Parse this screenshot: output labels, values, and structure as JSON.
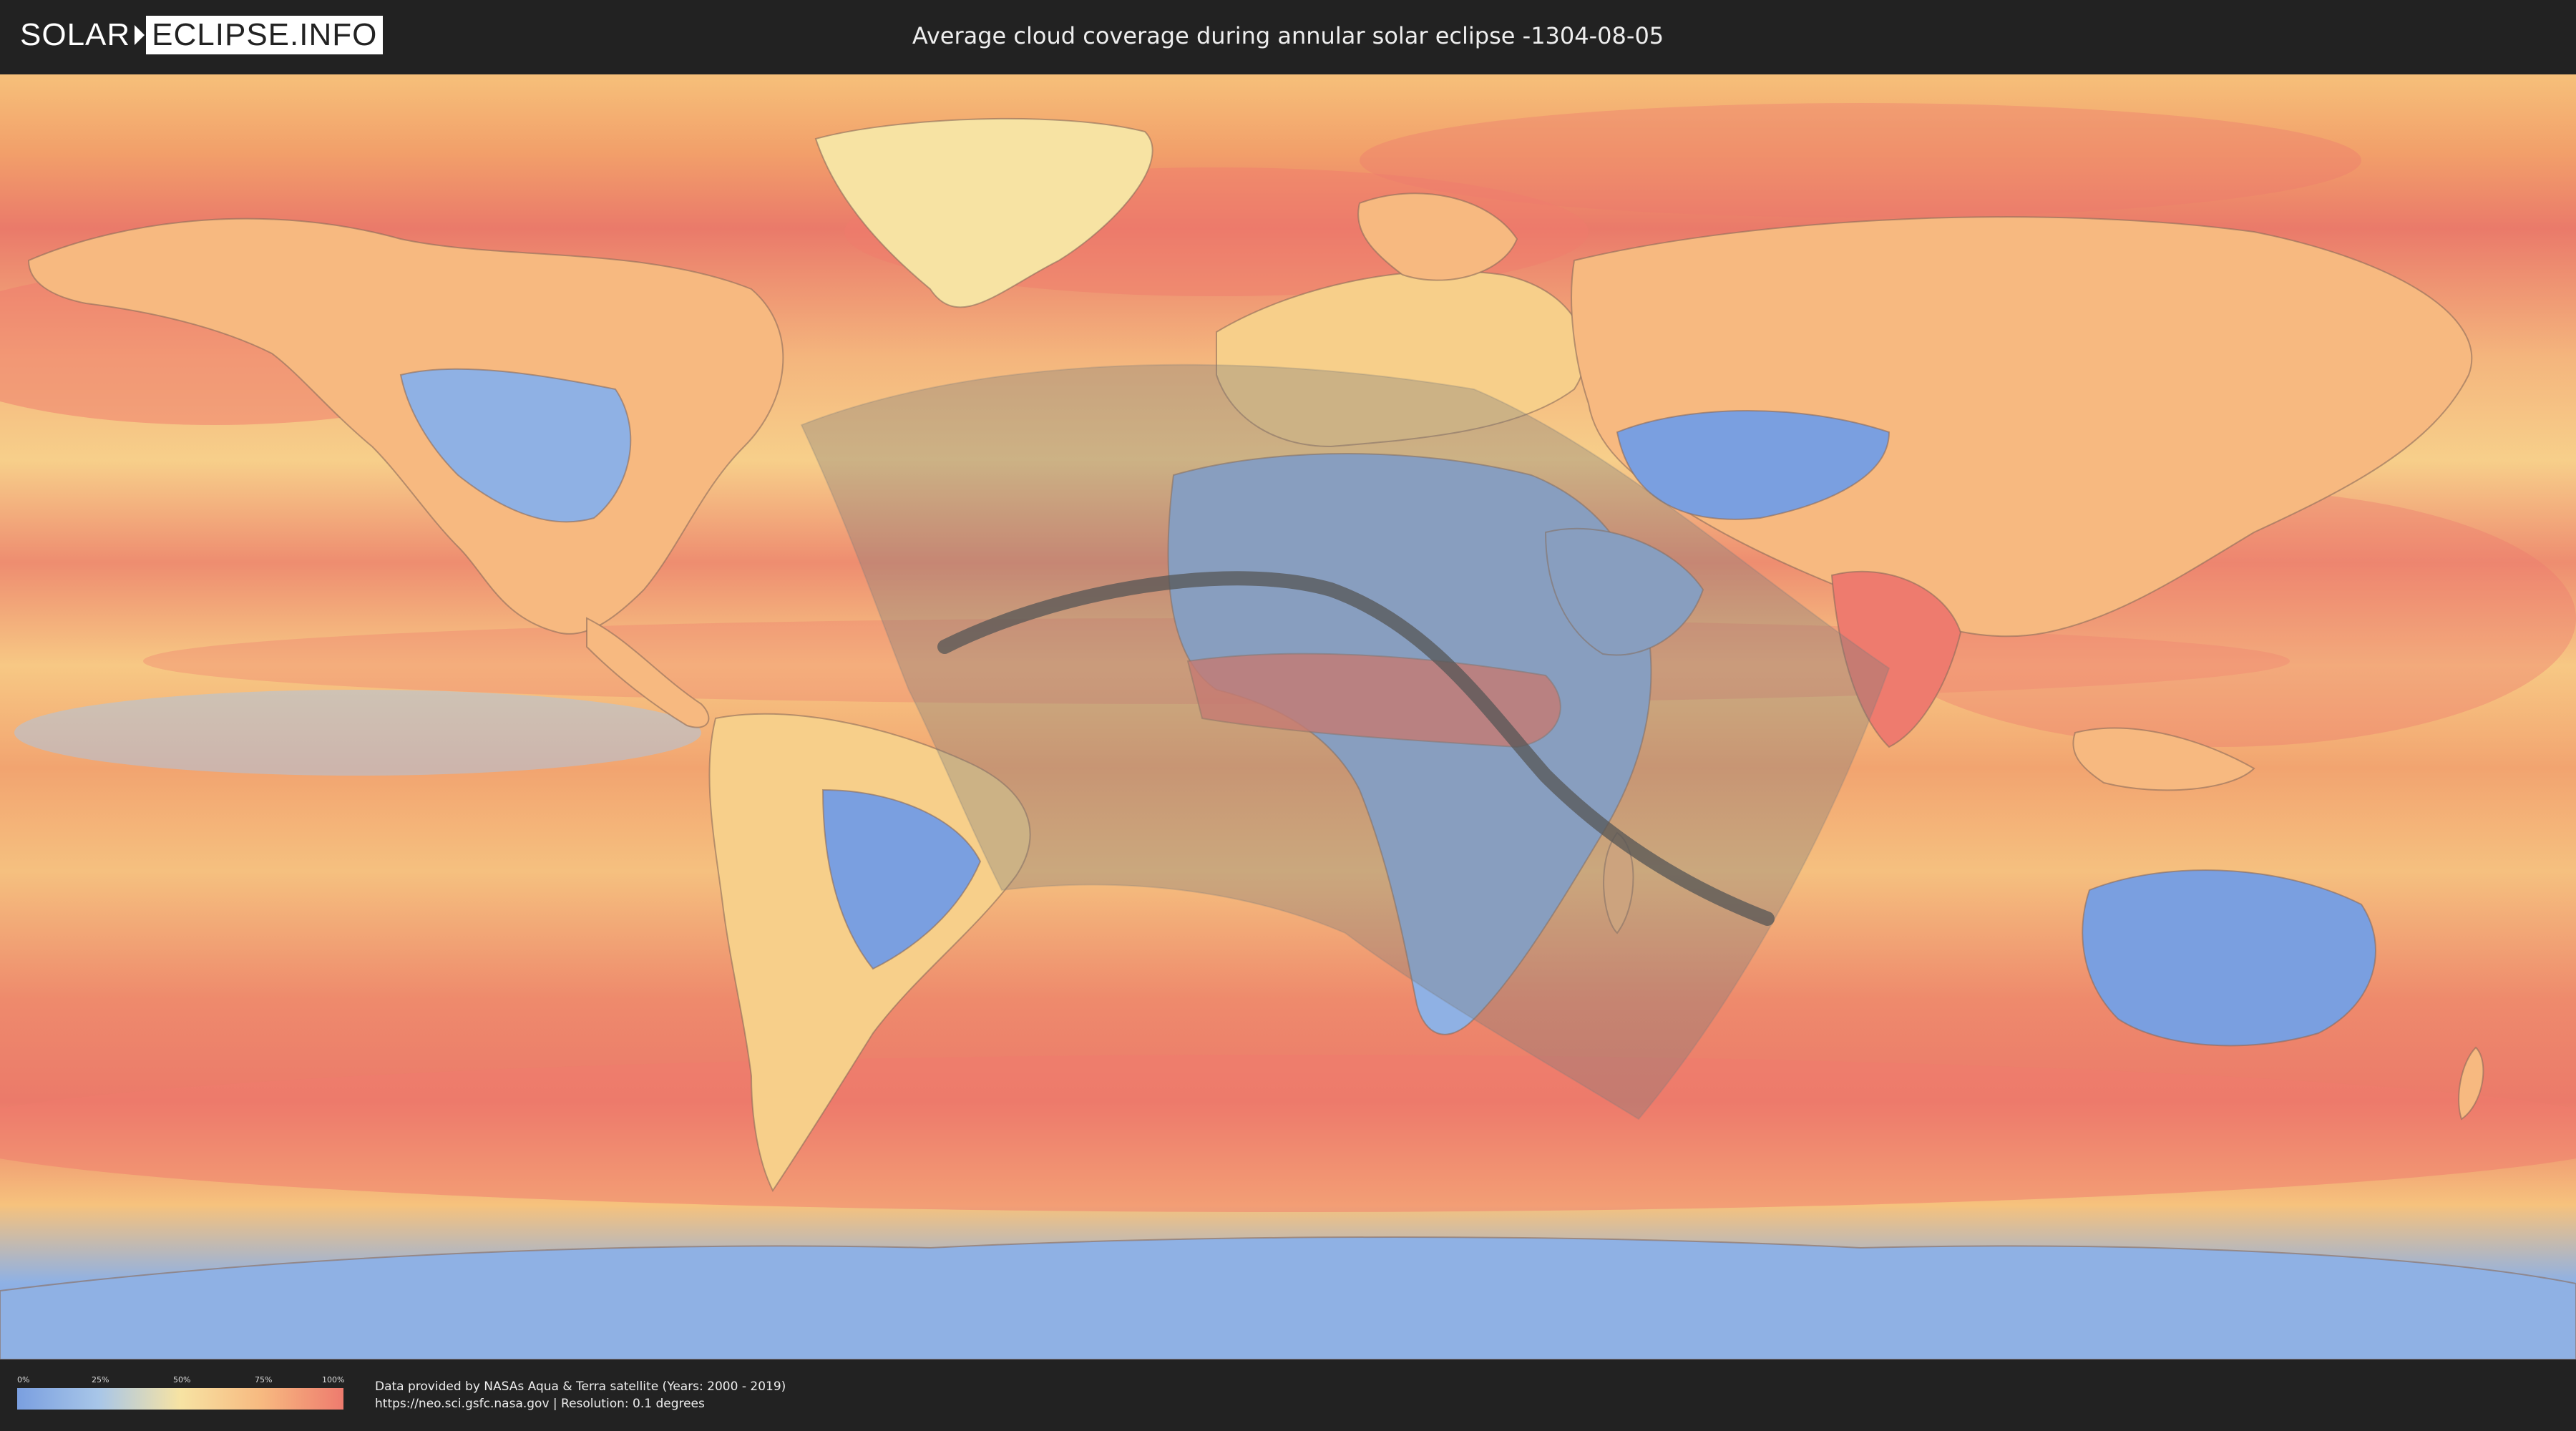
{
  "header": {
    "logo_left": "SOLAR",
    "logo_right": "ECLIPSE.INFO",
    "title": "Average cloud coverage during annular solar eclipse -1304-08-05"
  },
  "legend": {
    "ticks": [
      "0%",
      "25%",
      "50%",
      "75%",
      "100%"
    ],
    "colors": [
      "#7a9fe0",
      "#a8c6e8",
      "#f7e3a3",
      "#f7b980",
      "#ee7b6e"
    ]
  },
  "footer": {
    "line1": "Data provided by NASAs Aqua & Terra satellite (Years: 2000 - 2019)",
    "line2": "https://neo.sci.gsfc.nasa.gov | Resolution: 0.1 degrees"
  },
  "map": {
    "colors": {
      "clear": "#6f98e0",
      "low": "#a8c6e8",
      "mid": "#f7e3a3",
      "high": "#f7b980",
      "overcast": "#ee7b6e",
      "eclipse_shade": "#7a7a7a",
      "central_path": "#555555"
    }
  }
}
